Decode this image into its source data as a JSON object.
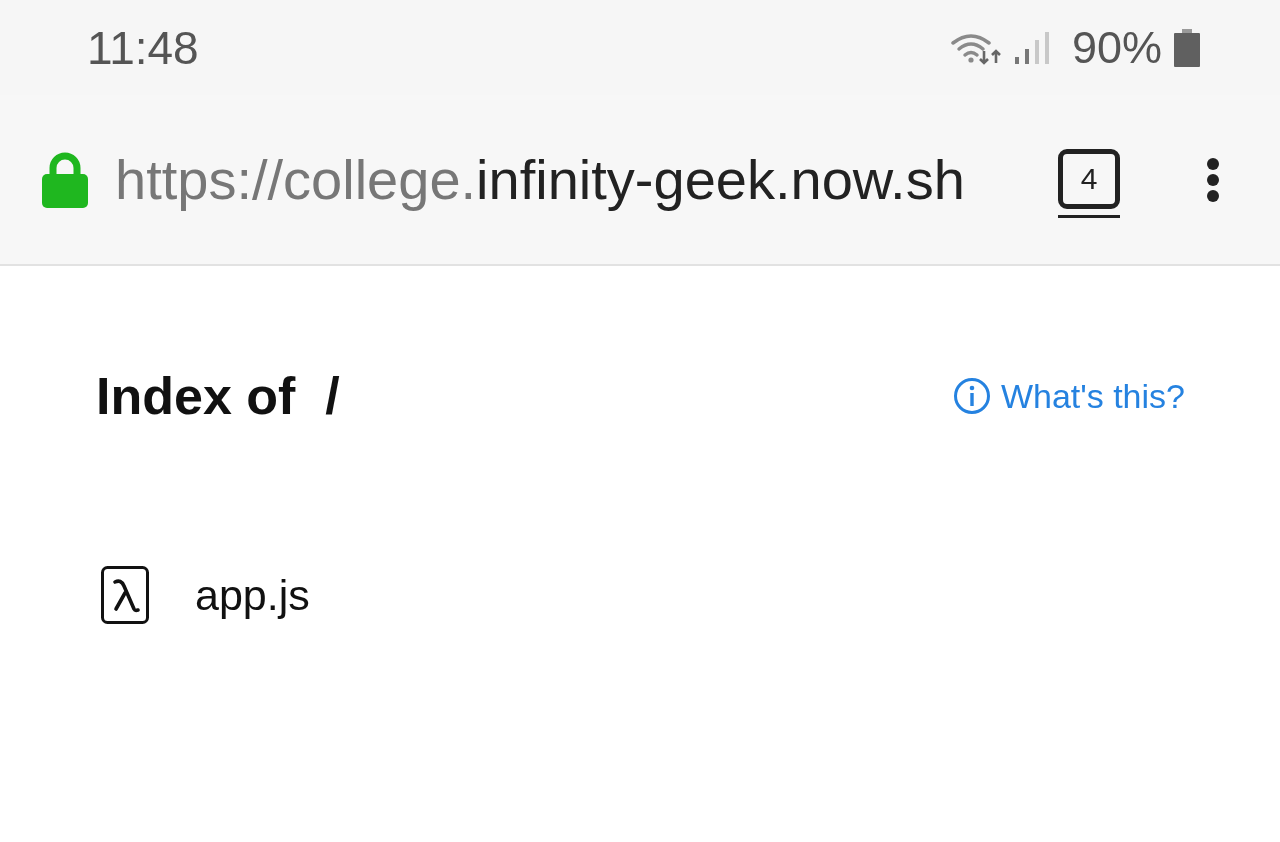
{
  "status_bar": {
    "time": "11:48",
    "battery": "90%"
  },
  "address_bar": {
    "secure": true,
    "url_prefix": "https://college.",
    "url_host": "infinity-geek.now.sh",
    "tab_count": "4"
  },
  "page": {
    "heading": "Index of",
    "path": "/",
    "help_link": "What's this?"
  },
  "files": [
    {
      "name": "app.js"
    }
  ]
}
